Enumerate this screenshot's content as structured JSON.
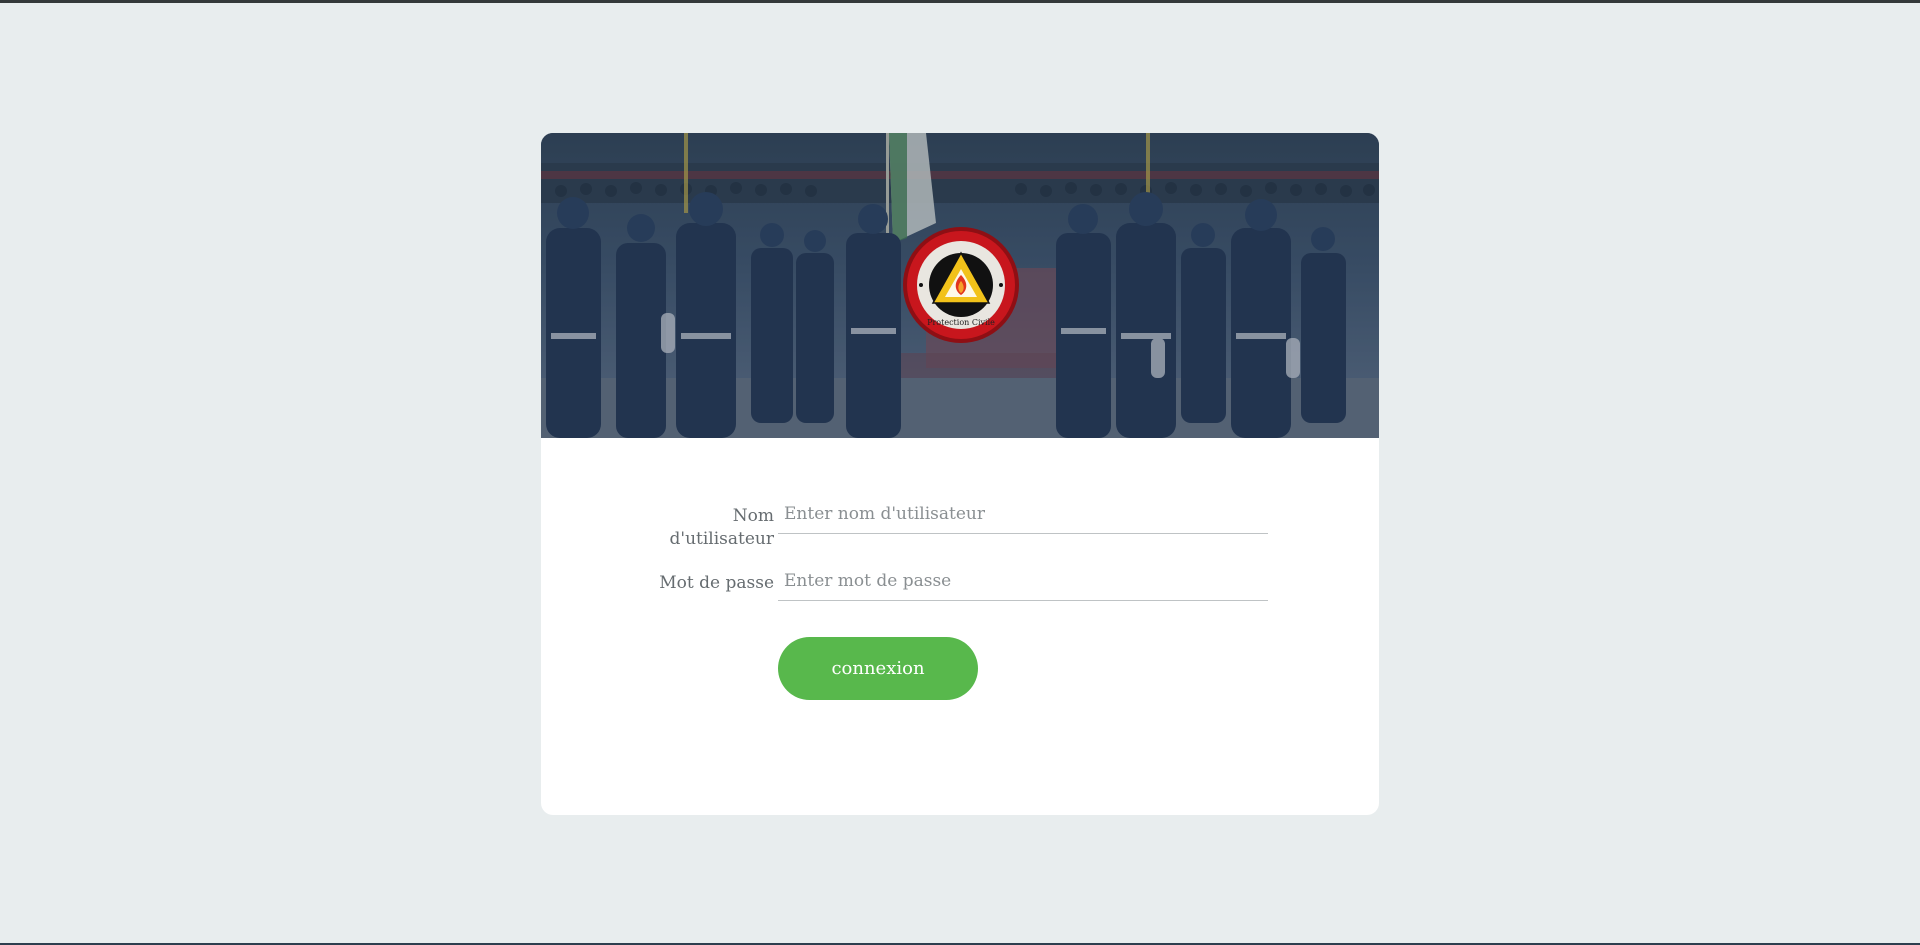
{
  "banner": {
    "emblem_text": "Protection Civile"
  },
  "login_form": {
    "username_label": "Nom d'utilisateur",
    "username_placeholder": "Enter nom d'utilisateur",
    "username_value": "",
    "password_label": "Mot de passe",
    "password_placeholder": "Enter mot de passe",
    "password_value": "",
    "submit_label": "connexion"
  },
  "colors": {
    "page_background": "#e8edee",
    "card_background": "#ffffff",
    "button": "#58b84c",
    "emblem_red": "#c8161d",
    "emblem_yellow": "#f2c21a"
  }
}
